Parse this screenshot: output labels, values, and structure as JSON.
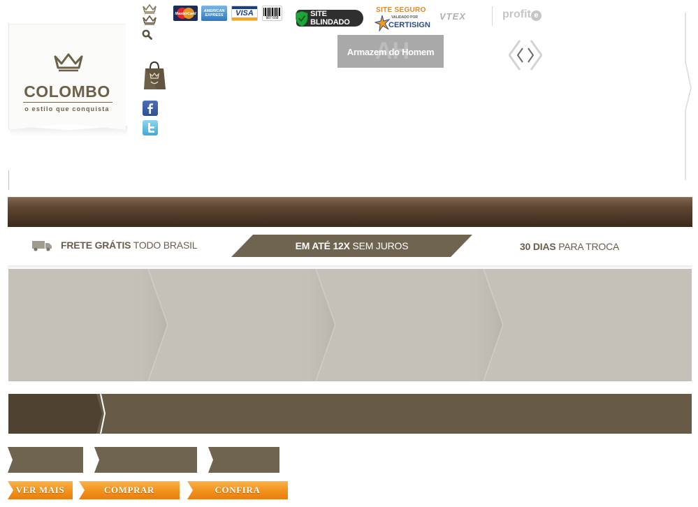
{
  "header": {
    "brand": {
      "name": "COLOMBO",
      "tagline": "o estilo que conquista"
    },
    "utility_icons": [
      "crown-icon",
      "crown-icon",
      "search-icon"
    ],
    "side_links": [
      "shopping-bag-icon",
      "facebook-icon",
      "twitter-icon"
    ]
  },
  "partners": {
    "cards": [
      {
        "name": "MasterCard",
        "icon": "mastercard-logo"
      },
      {
        "name": "AMERICAN EXPRESS",
        "icon": "amex-logo"
      },
      {
        "name": "VISA",
        "icon": "visa-logo"
      },
      {
        "name": "987 658",
        "icon": "boleto-logo"
      }
    ],
    "site_blindado": "SITE BLINDADO",
    "certisign": {
      "top": "SITE SEGURO",
      "mid": "VALIDADO POR",
      "bottom": "CERTISIGN"
    },
    "vtex": "VTEX",
    "profite": {
      "text": "profit",
      "badge": "e"
    }
  },
  "promo": {
    "armazem": {
      "label": "Armazem do Homem",
      "watermark": "AH"
    }
  },
  "benefits": {
    "frete": {
      "bold": "FRETE GRÁTIS",
      "rest": " TODO BRASIL"
    },
    "parcelas": {
      "bold": "EM ATÉ 12X",
      "rest": " SEM JUROS"
    },
    "troca": {
      "bold": "30 DIAS",
      "rest": " PARA TROCA"
    }
  },
  "buttons": {
    "ver_mais": "VER MAIS",
    "comprar": "COMPRAR",
    "confira": "CONFIRA"
  },
  "colors": {
    "brand_brown": "#6d6048",
    "bar_brown": "#4a3324",
    "tab_brown": "#6f6450",
    "banner_gray": "#c5c1b8",
    "cta_orange": "#f2941e"
  }
}
